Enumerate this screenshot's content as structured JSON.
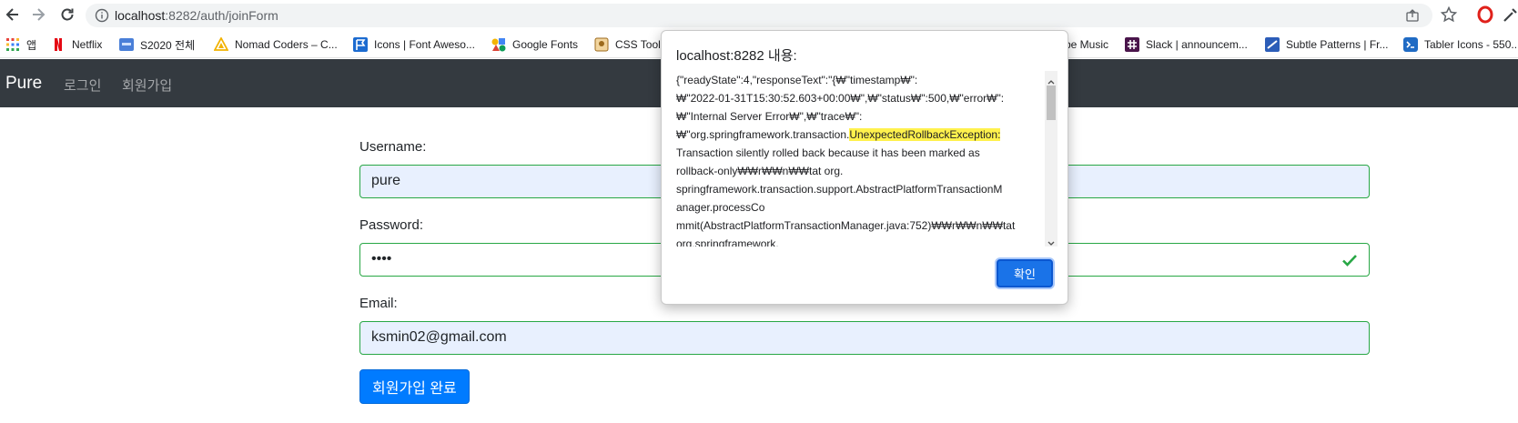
{
  "browser": {
    "url_host": "localhost",
    "url_rest": ":8282/auth/joinForm",
    "bookmarks": [
      {
        "label": "앱",
        "icon": "apps-grid-icon"
      },
      {
        "label": "Netflix",
        "icon": "netflix-icon"
      },
      {
        "label": "S2020 전체",
        "icon": "s2020-icon"
      },
      {
        "label": "Nomad Coders – C...",
        "icon": "nomad-coders-icon"
      },
      {
        "label": "Icons | Font Aweso...",
        "icon": "font-awesome-icon"
      },
      {
        "label": "Google Fonts",
        "icon": "google-fonts-icon"
      },
      {
        "label": "CSS Tool",
        "icon": "css-tools-icon"
      },
      {
        "label": "be Music",
        "icon": "youtube-music-icon"
      },
      {
        "label": "Slack | announcem...",
        "icon": "slack-icon"
      },
      {
        "label": "Subtle Patterns | Fr...",
        "icon": "subtle-patterns-icon"
      },
      {
        "label": "Tabler Icons - 550...",
        "icon": "tabler-icons-icon"
      }
    ]
  },
  "navbar": {
    "brand": "Pure",
    "links": [
      "로그인",
      "회원가입"
    ]
  },
  "form": {
    "username_label": "Username:",
    "username_value": "pure",
    "password_label": "Password:",
    "password_value": "••••",
    "email_label": "Email:",
    "email_value": "ksmin02@gmail.com",
    "submit_label": "회원가입 완료"
  },
  "dialog": {
    "title": "localhost:8282 내용:",
    "lines": [
      "{\"readyState\":4,\"responseText\":\"{₩\"timestamp₩\":",
      "₩\"2022-01-31T15:30:52.603+00:00₩\",₩\"status₩\":500,₩\"error₩\":",
      "₩\"Internal Server Error₩\",₩\"trace₩\":",
      "₩\"org.springframework.transaction.",
      "Transaction silently rolled back because it has been marked as",
      "rollback-only₩₩r₩₩n₩₩tat org.",
      "springframework.transaction.support.AbstractPlatformTransactionM",
      "anager.processCo",
      "mmit(AbstractPlatformTransactionManager.java:752)₩₩r₩₩n₩₩tat",
      "org.springframework."
    ],
    "highlight": "UnexpectedRollbackException:",
    "ok_label": "확인"
  },
  "colors": {
    "navbar_bg": "#343a40",
    "valid_border": "#28a745",
    "primary": "#007bff",
    "autofill_bg": "#e8f0fe",
    "highlight": "#fff14d"
  }
}
